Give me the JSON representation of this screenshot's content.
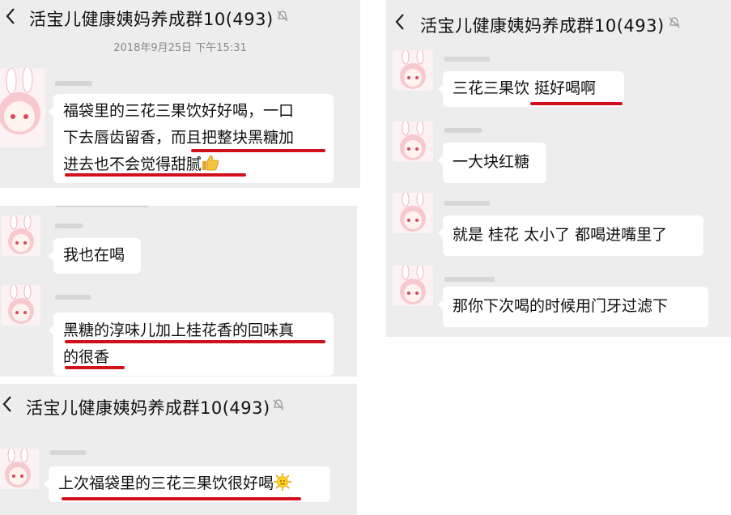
{
  "chat": {
    "title": "活宝儿健康姨妈养成群10(493)",
    "back_glyph": "<",
    "timestamp": "2018年9月25日 下午15:31"
  },
  "panel_a": {
    "messages": [
      {
        "lines": [
          "福袋里的三花三果饮好好喝，一口",
          "下去唇齿留香，而且把整块黑糖加",
          "进去也不会觉得甜腻"
        ],
        "emoji": "thumbs-up-icon"
      },
      {
        "lines": [
          "我也在喝"
        ]
      },
      {
        "lines": [
          "黑糖的淳味儿加上桂花香的回味真",
          "的很香"
        ]
      }
    ]
  },
  "panel_b": {
    "messages": [
      {
        "lines": [
          "三花三果饮 挺好喝啊"
        ]
      },
      {
        "lines": [
          "一大块红糖"
        ]
      },
      {
        "lines": [
          "就是 桂花 太小了 都喝进嘴里了"
        ]
      },
      {
        "lines": [
          "那你下次喝的时候用门牙过滤下"
        ]
      }
    ]
  },
  "panel_c": {
    "messages": [
      {
        "lines": [
          "上次福袋里的三花三果饮很好喝"
        ],
        "emoji": "sun-face-icon"
      }
    ]
  },
  "colors": {
    "chat_background": "#ededed",
    "bubble": "#ffffff",
    "highlight_underline": "#d0101a"
  }
}
